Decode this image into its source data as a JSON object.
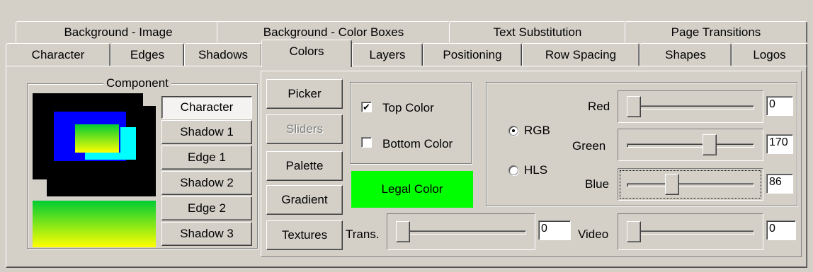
{
  "tabs": {
    "row1": [
      "Background - Image",
      "Background - Color Boxes",
      "Text Substitution",
      "Page Transitions"
    ],
    "row2": [
      "Character",
      "Edges",
      "Shadows",
      "Colors",
      "Layers",
      "Positioning",
      "Row Spacing",
      "Shapes",
      "Logos"
    ],
    "active": "Colors"
  },
  "component": {
    "group_title": "Component",
    "buttons": [
      "Character",
      "Shadow 1",
      "Edge 1",
      "Shadow 2",
      "Edge 2",
      "Shadow 3"
    ],
    "selected": "Character",
    "gradient": {
      "top": "#00cc33",
      "bottom": "#ffff00"
    }
  },
  "modes": {
    "buttons": [
      "Picker",
      "Sliders",
      "Palette",
      "Gradient",
      "Textures"
    ],
    "disabled": "Sliders"
  },
  "color_flags": {
    "top_color": {
      "label": "Top Color",
      "checked": true
    },
    "bottom_color": {
      "label": "Bottom Color",
      "checked": false
    },
    "legal_label": "Legal Color",
    "legal_color": "#00ff00"
  },
  "color_model": {
    "rgb_label": "RGB",
    "hls_label": "HLS",
    "selected": "RGB"
  },
  "channels": {
    "red": {
      "label": "Red",
      "value": "0",
      "level": 0.0
    },
    "green": {
      "label": "Green",
      "value": "170",
      "level": 0.667
    },
    "blue": {
      "label": "Blue",
      "value": "86",
      "level": 0.337
    }
  },
  "trans": {
    "label": "Trans.",
    "value": "0",
    "level": 0.0
  },
  "video": {
    "label": "Video",
    "value": "0",
    "level": 0.0
  }
}
